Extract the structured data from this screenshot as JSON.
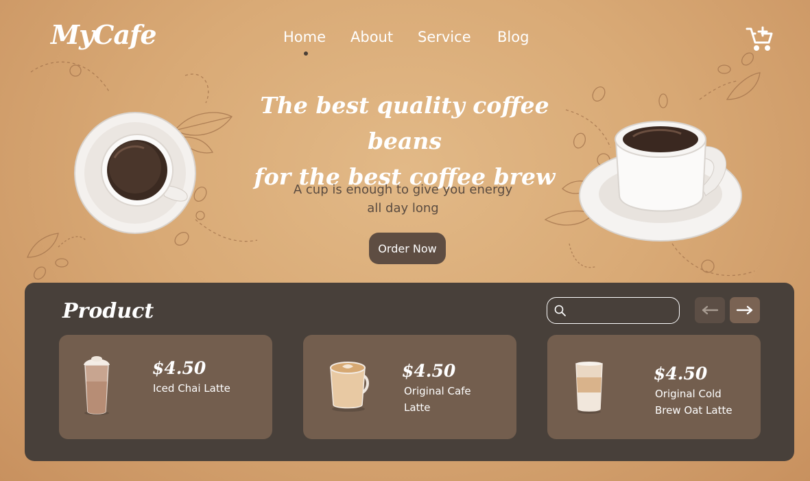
{
  "brand": {
    "logo": "MyCafe"
  },
  "nav": {
    "items": [
      "Home",
      "About",
      "Service",
      "Blog"
    ],
    "active": "Home"
  },
  "hero": {
    "title_line1": "The best quality coffee beans",
    "title_line2": "for the best coffee brew",
    "subtitle_line1": "A cup is enough to give you energy",
    "subtitle_line2": "all day long",
    "cta": "Order Now"
  },
  "products": {
    "title": "Product",
    "search_placeholder": "",
    "items": [
      {
        "price": "$4.50",
        "name_line1": "Iced Chai Latte",
        "name_line2": ""
      },
      {
        "price": "$4.50",
        "name_line1": "Original Cafe",
        "name_line2": "Latte"
      },
      {
        "price": "$4.50",
        "name_line1": "Original Cold",
        "name_line2": "Brew Oat Latte"
      }
    ]
  },
  "icons": [
    "cart-plus-icon",
    "search-icon",
    "arrow-left-icon",
    "arrow-right-icon"
  ],
  "colors": {
    "background": "#d9aa76",
    "panel": "#48403a",
    "card": "#735e4e",
    "button": "#5e4d42",
    "text_light": "#ffffff",
    "text_dark": "#5a4b40"
  }
}
